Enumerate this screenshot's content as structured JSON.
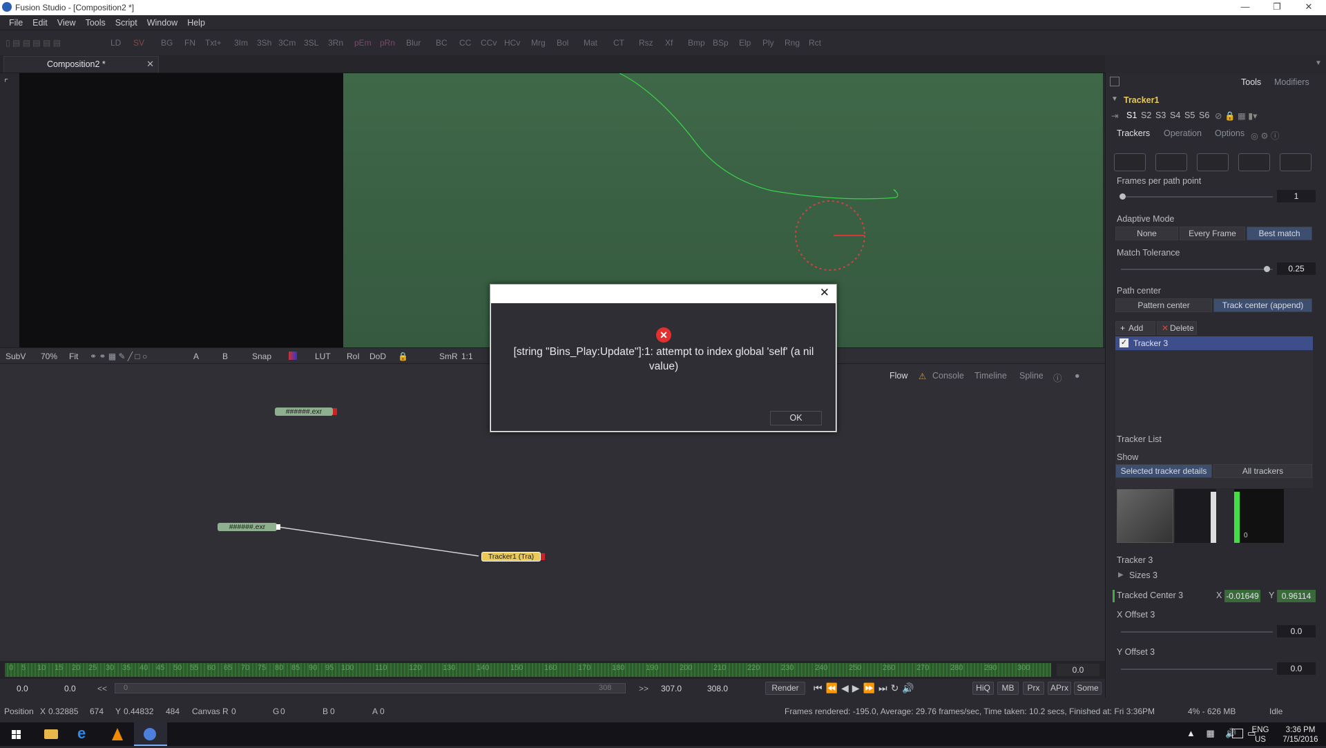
{
  "window": {
    "title": "Fusion Studio - [Composition2 *]"
  },
  "menu": [
    "File",
    "Edit",
    "View",
    "Tools",
    "Script",
    "Window",
    "Help"
  ],
  "toolbar": [
    "LD",
    "SV",
    "BG",
    "FN",
    "Txt+",
    "3Im",
    "3Sh",
    "3Cm",
    "3SL",
    "3Rn",
    "pEm",
    "pRn",
    "Blur",
    "BC",
    "CC",
    "CCv",
    "HCv",
    "Mrg",
    "Bol",
    "Mat",
    "CT",
    "Rsz",
    "Xf",
    "Bmp",
    "BSp",
    "Elp",
    "Ply",
    "Rng",
    "Rct"
  ],
  "tab": {
    "label": "Composition2 *"
  },
  "viewer_toolbar": {
    "subv": "SubV",
    "zoom": "70%",
    "fit": "Fit",
    "a": "A",
    "b": "B",
    "snap": "Snap",
    "lut": "LUT",
    "roi": "RoI",
    "dod": "DoD",
    "smr": "SmR",
    "ratio": "1:1"
  },
  "flow": {
    "tabs": [
      "Flow",
      "Console",
      "Timeline",
      "Spline"
    ],
    "nodes": {
      "loader1": "######.exr",
      "loader2": "######.exr",
      "tracker": "Tracker1  (Tra)"
    }
  },
  "timeline": {
    "ticks": [
      "0",
      "5",
      "10",
      "15",
      "20",
      "25",
      "30",
      "35",
      "40",
      "45",
      "50",
      "55",
      "60",
      "65",
      "70",
      "75",
      "80",
      "85",
      "90",
      "95",
      "100",
      "110",
      "120",
      "130",
      "140",
      "150",
      "160",
      "170",
      "180",
      "190",
      "200",
      "210",
      "220",
      "230",
      "240",
      "250",
      "260",
      "270",
      "280",
      "290",
      "300"
    ],
    "current_time": "0.0",
    "range_label": "308"
  },
  "transport": {
    "start": "0.0",
    "render_start": "0.0",
    "prev_label": "<<",
    "range_start": "0",
    "next_label": ">>",
    "render_end": "307.0",
    "end": "308.0",
    "render": "Render",
    "hiq": "HiQ",
    "mb": "MB",
    "prx": "Prx",
    "aprx": "APrx",
    "some": "Some"
  },
  "status": {
    "position_label": "Position",
    "x_label": "X",
    "x_val": "0.32885",
    "x_px": "674",
    "y_label": "Y",
    "y_val": "0.44832",
    "y_px": "484",
    "canvas": "Canvas R",
    "r_val": "0",
    "g": "G",
    "g_val": "0",
    "b": "B",
    "b_val": "0",
    "a": "A",
    "a_val": "0",
    "frames": "Frames rendered: -195.0,  Average: 29.76 frames/sec,  Time taken: 10.2 secs,  Finished at: Fri 3:36PM",
    "memory": "4% - 626 MB",
    "state": "Idle"
  },
  "inspector": {
    "tools_tab": "Tools",
    "modifiers_tab": "Modifiers",
    "tool_name": "Tracker1",
    "slots": [
      "S1",
      "S2",
      "S3",
      "S4",
      "S5",
      "S6"
    ],
    "subtabs": [
      "Trackers",
      "Operation",
      "Options"
    ],
    "frames_per_path_point": {
      "label": "Frames per path point",
      "value": "1"
    },
    "adaptive_mode": {
      "label": "Adaptive Mode",
      "options": [
        "None",
        "Every Frame",
        "Best match"
      ],
      "selected": "Best match"
    },
    "match_tolerance": {
      "label": "Match Tolerance",
      "value": "0.25"
    },
    "path_center": {
      "label": "Path center",
      "options": [
        "Pattern center",
        "Track center (append)"
      ],
      "selected": "Track center (append)"
    },
    "add": "Add",
    "delete": "Delete",
    "tracker_item": "Tracker 3",
    "tracker_list_label": "Tracker List",
    "show_label": "Show",
    "show_options": [
      "Selected tracker details",
      "All trackers"
    ],
    "preview_zero": "0",
    "tracker_label": "Tracker 3",
    "sizes": "Sizes 3",
    "tracked_center": {
      "label": "Tracked Center 3",
      "x_label": "X",
      "x": "-0.01649",
      "y_label": "Y",
      "y": "0.96114"
    },
    "x_offset": {
      "label": "X Offset 3",
      "value": "0.0"
    },
    "y_offset": {
      "label": "Y Offset 3",
      "value": "0.0"
    }
  },
  "dialog": {
    "message": "[string \"Bins_Play:Update\"]:1: attempt to index global 'self' (a nil value)",
    "ok": "OK"
  },
  "taskbar": {
    "lang": "ENG",
    "region": "US",
    "time": "3:36 PM",
    "date": "7/15/2016"
  }
}
